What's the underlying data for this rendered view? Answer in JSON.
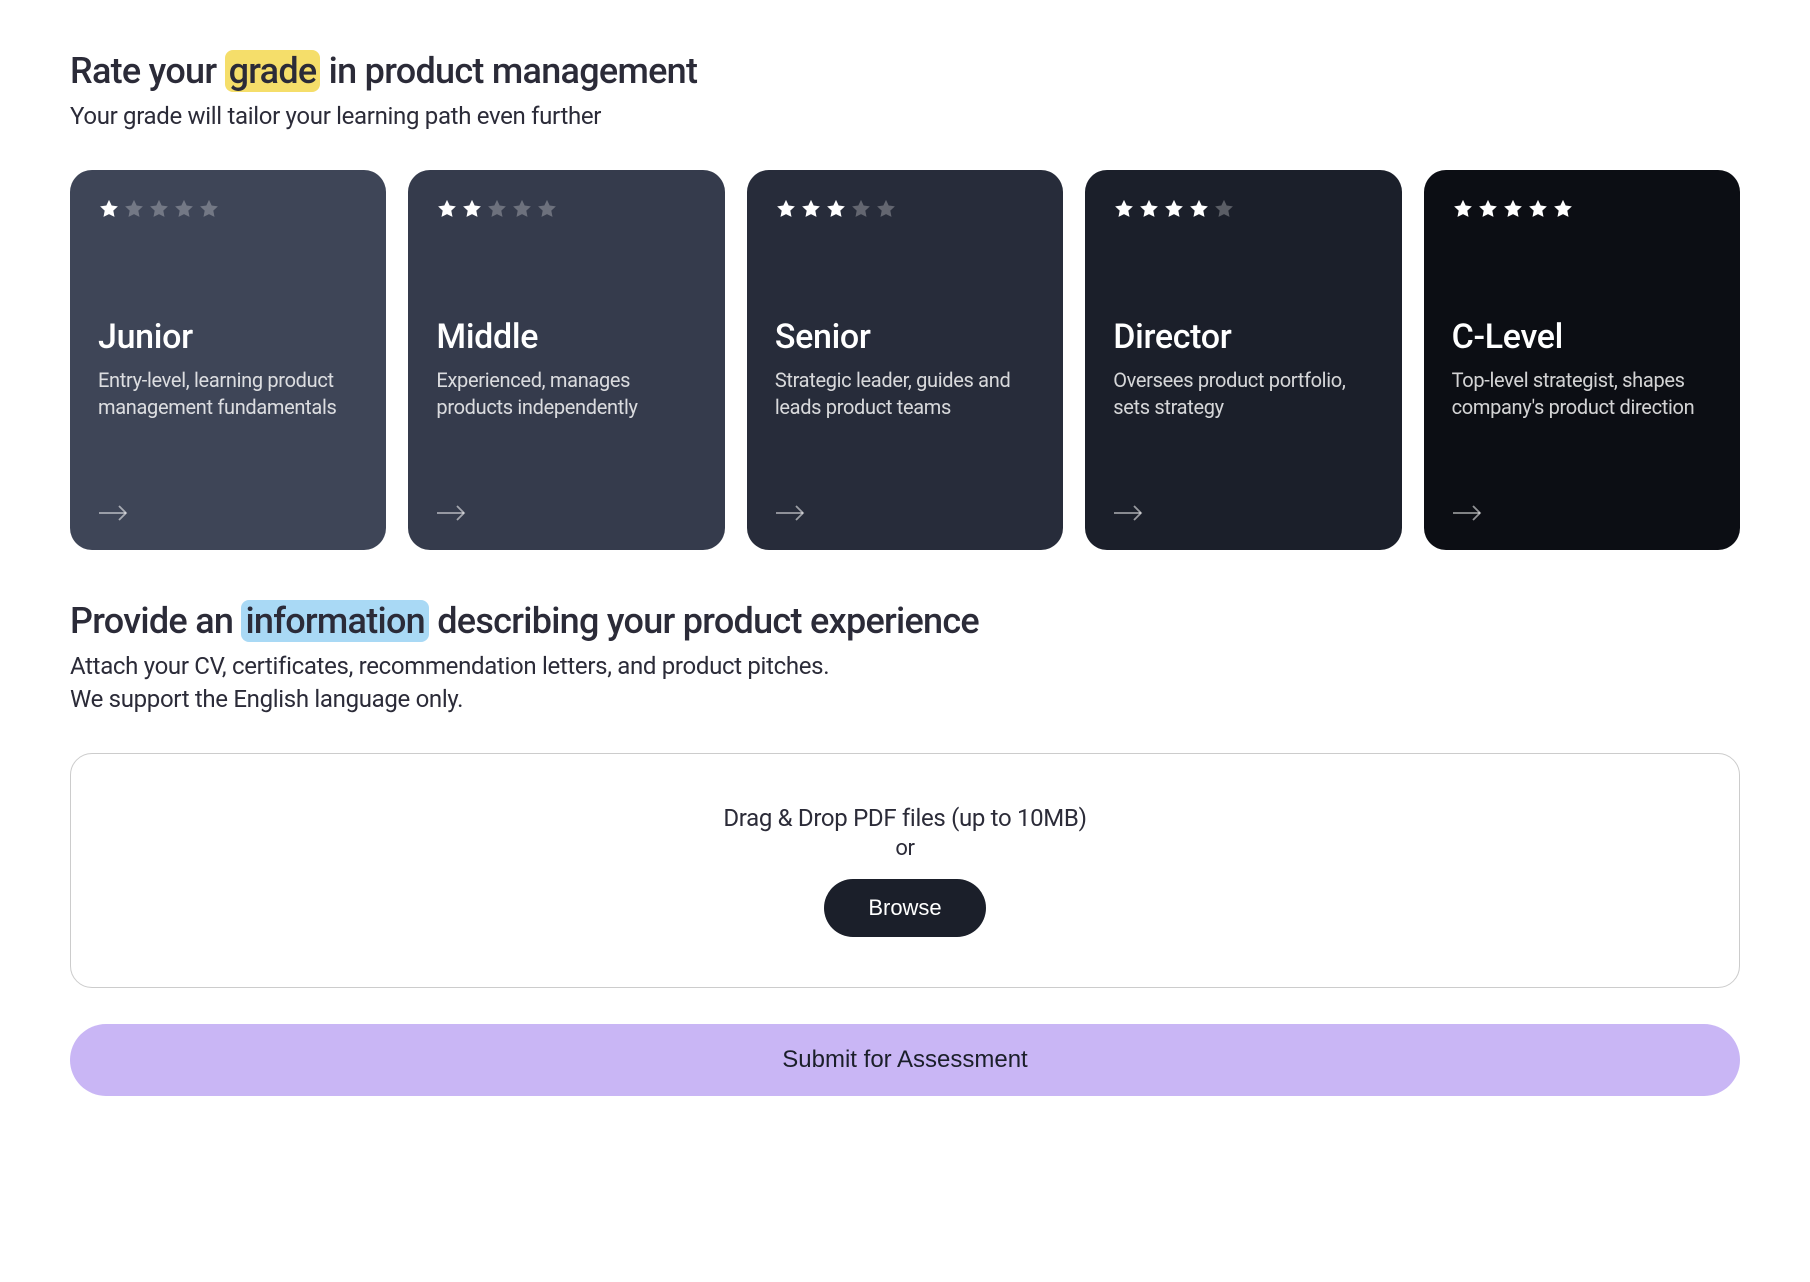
{
  "grade_section": {
    "heading_pre": "Rate your ",
    "heading_highlight": "grade",
    "heading_post": " in product management",
    "subtitle": "Your grade will tailor your learning path even further",
    "cards": [
      {
        "stars": 1,
        "title": "Junior",
        "desc": "Entry-level, learning product management fundamentals"
      },
      {
        "stars": 2,
        "title": "Middle",
        "desc": "Experienced, manages products independently"
      },
      {
        "stars": 3,
        "title": "Senior",
        "desc": "Strategic leader, guides and leads product teams"
      },
      {
        "stars": 4,
        "title": "Director",
        "desc": "Oversees product portfolio, sets strategy"
      },
      {
        "stars": 5,
        "title": "C-Level",
        "desc": "Top-level strategist, shapes company's product direction"
      }
    ]
  },
  "info_section": {
    "heading_pre": "Provide an ",
    "heading_highlight": "information",
    "heading_post": " describing your product experience",
    "subtitle_line1": "Attach your CV, certificates, recommendation letters, and product pitches.",
    "subtitle_line2": "We support the English language only."
  },
  "upload": {
    "drag_text": "Drag & Drop PDF files (up to 10MB)",
    "or_text": "or",
    "browse_label": "Browse"
  },
  "submit": {
    "label": "Submit for Assessment"
  }
}
